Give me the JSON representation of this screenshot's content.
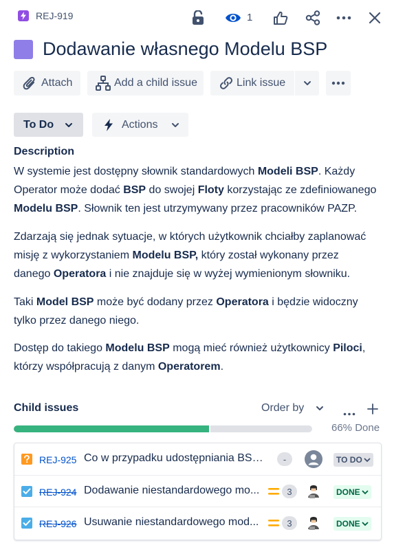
{
  "header": {
    "issue_key": "REJ-919",
    "watch_count": "1",
    "icons": [
      "epic-lightning-icon",
      "lock-icon",
      "eye-icon",
      "thumbs-up-icon",
      "share-icon",
      "more-icon",
      "close-icon"
    ]
  },
  "title": "Dodawanie własnego Modelu BSP",
  "toolbar": {
    "attach": "Attach",
    "add_child": "Add a child issue",
    "link": "Link issue"
  },
  "status_bar": {
    "status": "To Do",
    "actions": "Actions"
  },
  "description": {
    "label": "Description",
    "p1": [
      {
        "t": "W systemie jest dostępny słownik standardowych ",
        "b": false
      },
      {
        "t": "Modeli BSP",
        "b": true
      },
      {
        "t": ". Każdy\nOperator może dodać ",
        "b": false
      },
      {
        "t": "BSP",
        "b": true
      },
      {
        "t": " do swojej ",
        "b": false
      },
      {
        "t": "Floty",
        "b": true
      },
      {
        "t": " korzystając ze zdefiniowanego\n",
        "b": false
      },
      {
        "t": "Modelu BSP",
        "b": true
      },
      {
        "t": ". Słownik ten jest utrzymywany przez pracowników PAZP.",
        "b": false
      }
    ],
    "p2": [
      {
        "t": "Zdarzają się jednak sytuacje, w których użytkownik chciałby zaplanować\nmisję z wykorzystaniem ",
        "b": false
      },
      {
        "t": "Modelu BSP,",
        "b": true
      },
      {
        "t": " który został  wykonany przez\ndanego ",
        "b": false
      },
      {
        "t": "Operatora",
        "b": true
      },
      {
        "t": " i nie znajduje się w wyżej wymienionym słowniku.",
        "b": false
      }
    ],
    "p3": [
      {
        "t": "Taki ",
        "b": false
      },
      {
        "t": "Model BSP",
        "b": true
      },
      {
        "t": " może być dodany przez ",
        "b": false
      },
      {
        "t": "Operatora",
        "b": true
      },
      {
        "t": " i będzie widoczny\ntylko przez danego niego.",
        "b": false
      }
    ],
    "p4": [
      {
        "t": "Dostęp do takiego ",
        "b": false
      },
      {
        "t": "Modelu BSP",
        "b": true
      },
      {
        "t": " mogą mieć również użytkownicy ",
        "b": false
      },
      {
        "t": "Piloci",
        "b": true
      },
      {
        "t": ",\nktórzy współpracują z danym ",
        "b": false
      },
      {
        "t": "Operatorem",
        "b": true
      },
      {
        "t": ".",
        "b": false
      }
    ]
  },
  "child_issues": {
    "label": "Child issues",
    "order_by": "Order by",
    "progress": 0.66,
    "progress_text": "66% Done",
    "items": [
      {
        "type": "question",
        "key": "REJ-925",
        "done": false,
        "summary": "Co w przypadku udostępniania BSP st...",
        "priority": "none",
        "estimate": "-",
        "avatar": "unassigned",
        "status": "TO DO"
      },
      {
        "type": "task",
        "key": "REJ-924",
        "done": true,
        "summary": "Dodawanie niestandardowego mo...",
        "priority": "medium",
        "estimate": "3",
        "avatar": "user",
        "status": "DONE"
      },
      {
        "type": "task",
        "key": "REJ-926",
        "done": true,
        "summary": "Usuwanie niestandardowego mod...",
        "priority": "medium",
        "estimate": "3",
        "avatar": "user",
        "status": "DONE"
      }
    ]
  },
  "colors": {
    "epic": "#904ee2",
    "title_swatch": "#8f7ee7",
    "progress": "#36b37e",
    "link": "#0052cc",
    "question": "#ff991f",
    "task": "#4bade8",
    "priority_medium": "#ffab00"
  }
}
